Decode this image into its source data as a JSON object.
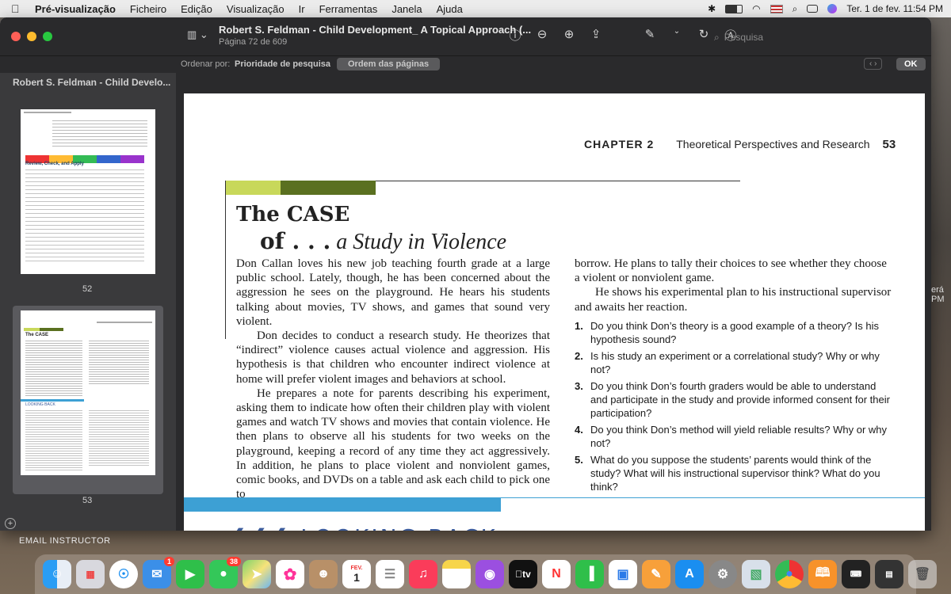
{
  "menubar": {
    "app_name": "Pré-visualização",
    "items": [
      "Ficheiro",
      "Edição",
      "Visualização",
      "Ir",
      "Ferramentas",
      "Janela",
      "Ajuda"
    ],
    "clock": "Ter. 1 de fev. 11:54 PM"
  },
  "window": {
    "doc_title": "Robert S. Feldman - Child Development_ A Topical Approach (...",
    "page_indicator": "Página 72 de 609",
    "search_placeholder": "Pesquisa"
  },
  "sortbar": {
    "label": "Ordenar por:",
    "option_priority": "Prioridade de pesquisa",
    "option_page_order": "Ordem das páginas",
    "ok": "OK"
  },
  "sidebar": {
    "title": "Robert S. Feldman - Child Develo...",
    "thumb_52_heading": "Review, Check, and Apply",
    "thumb_53_case": "The CASE",
    "thumb_53_looking": "LOOKING BACK",
    "page_52": "52",
    "page_53": "53",
    "email": "EMAIL INSTRUCTOR"
  },
  "page": {
    "chapter_label": "CHAPTER 2",
    "chapter_title": "Theoretical Perspectives and Research",
    "page_number": "53",
    "case_title_1": "The CASE",
    "case_title_of": "of . . .",
    "case_title_2": "a Study in Violence",
    "left_p1": "Don Callan loves his new job teaching fourth grade at a large public school. Lately, though, he has been concerned about the aggression he sees on the playground. He hears his students talking about movies, TV shows, and games that sound very violent.",
    "left_p2": "Don decides to conduct a research study. He theorizes that “indirect” violence causes actual violence and aggression. His hypothesis is that children who encounter indirect violence at home will prefer violent images and behaviors at school.",
    "left_p3": "He prepares a note for parents describing his experiment, asking them to indicate how often their children play with violent games and watch TV shows and movies that contain violence. He then plans to observe all his students for two weeks on the playground, keeping a record of any time they act aggressively. In addition, he plans to place violent and nonviolent games, comic books, and DVDs on a table and ask each child to pick one to",
    "right_p1": "borrow. He plans to tally their choices to see whether they choose a violent or nonviolent game.",
    "right_p2": "He shows his experimental plan to his instructional supervisor and awaits her reaction.",
    "questions": [
      {
        "n": "1.",
        "text": "Do you think Don’s theory is a good example of a theory? Is his hypothesis sound?"
      },
      {
        "n": "2.",
        "text": "Is his study an experiment or a correlational study? Why or why not?"
      },
      {
        "n": "3.",
        "text": "Do you think Don’s fourth graders would be able to understand and participate in the study and provide informed consent for their participation?"
      },
      {
        "n": "4.",
        "text": "Do you think Don’s method will yield reliable results? Why or why not?"
      },
      {
        "n": "5.",
        "text": "What do you suppose the students’ parents would think of the study? What will his instructional supervisor think? What do you think?"
      }
    ],
    "looking_back": "LOOKING BACK"
  },
  "right_peek": "erá\nPM",
  "dock": {
    "badge_mail": "1",
    "badge_messages": "38",
    "calendar_month": "FEV.",
    "calendar_day": "1",
    "tv_label": "tv"
  }
}
